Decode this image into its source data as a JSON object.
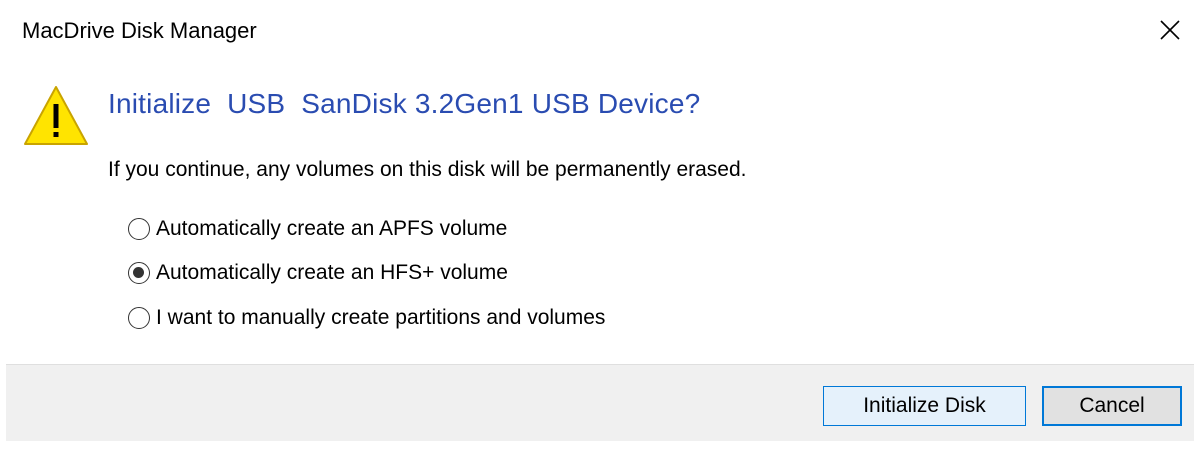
{
  "window": {
    "title": "MacDrive Disk Manager",
    "close_icon": "close-icon"
  },
  "dialog": {
    "icon": "warning-icon",
    "heading": "Initialize  USB  SanDisk 3.2Gen1 USB Device?",
    "message": "If you continue, any volumes on this disk will be permanently erased.",
    "options": [
      {
        "label": "Automatically create an APFS volume",
        "checked": false
      },
      {
        "label": "Automatically create an HFS+ volume",
        "checked": true
      },
      {
        "label": "I want to manually create partitions and volumes",
        "checked": false
      }
    ]
  },
  "buttons": {
    "initialize_label": "Initialize Disk",
    "cancel_label": "Cancel"
  },
  "colors": {
    "heading": "#2a4cb1",
    "warning_fill": "#ffe400",
    "focus_border": "#0078d7",
    "footer_bg": "#f0f0f0"
  }
}
